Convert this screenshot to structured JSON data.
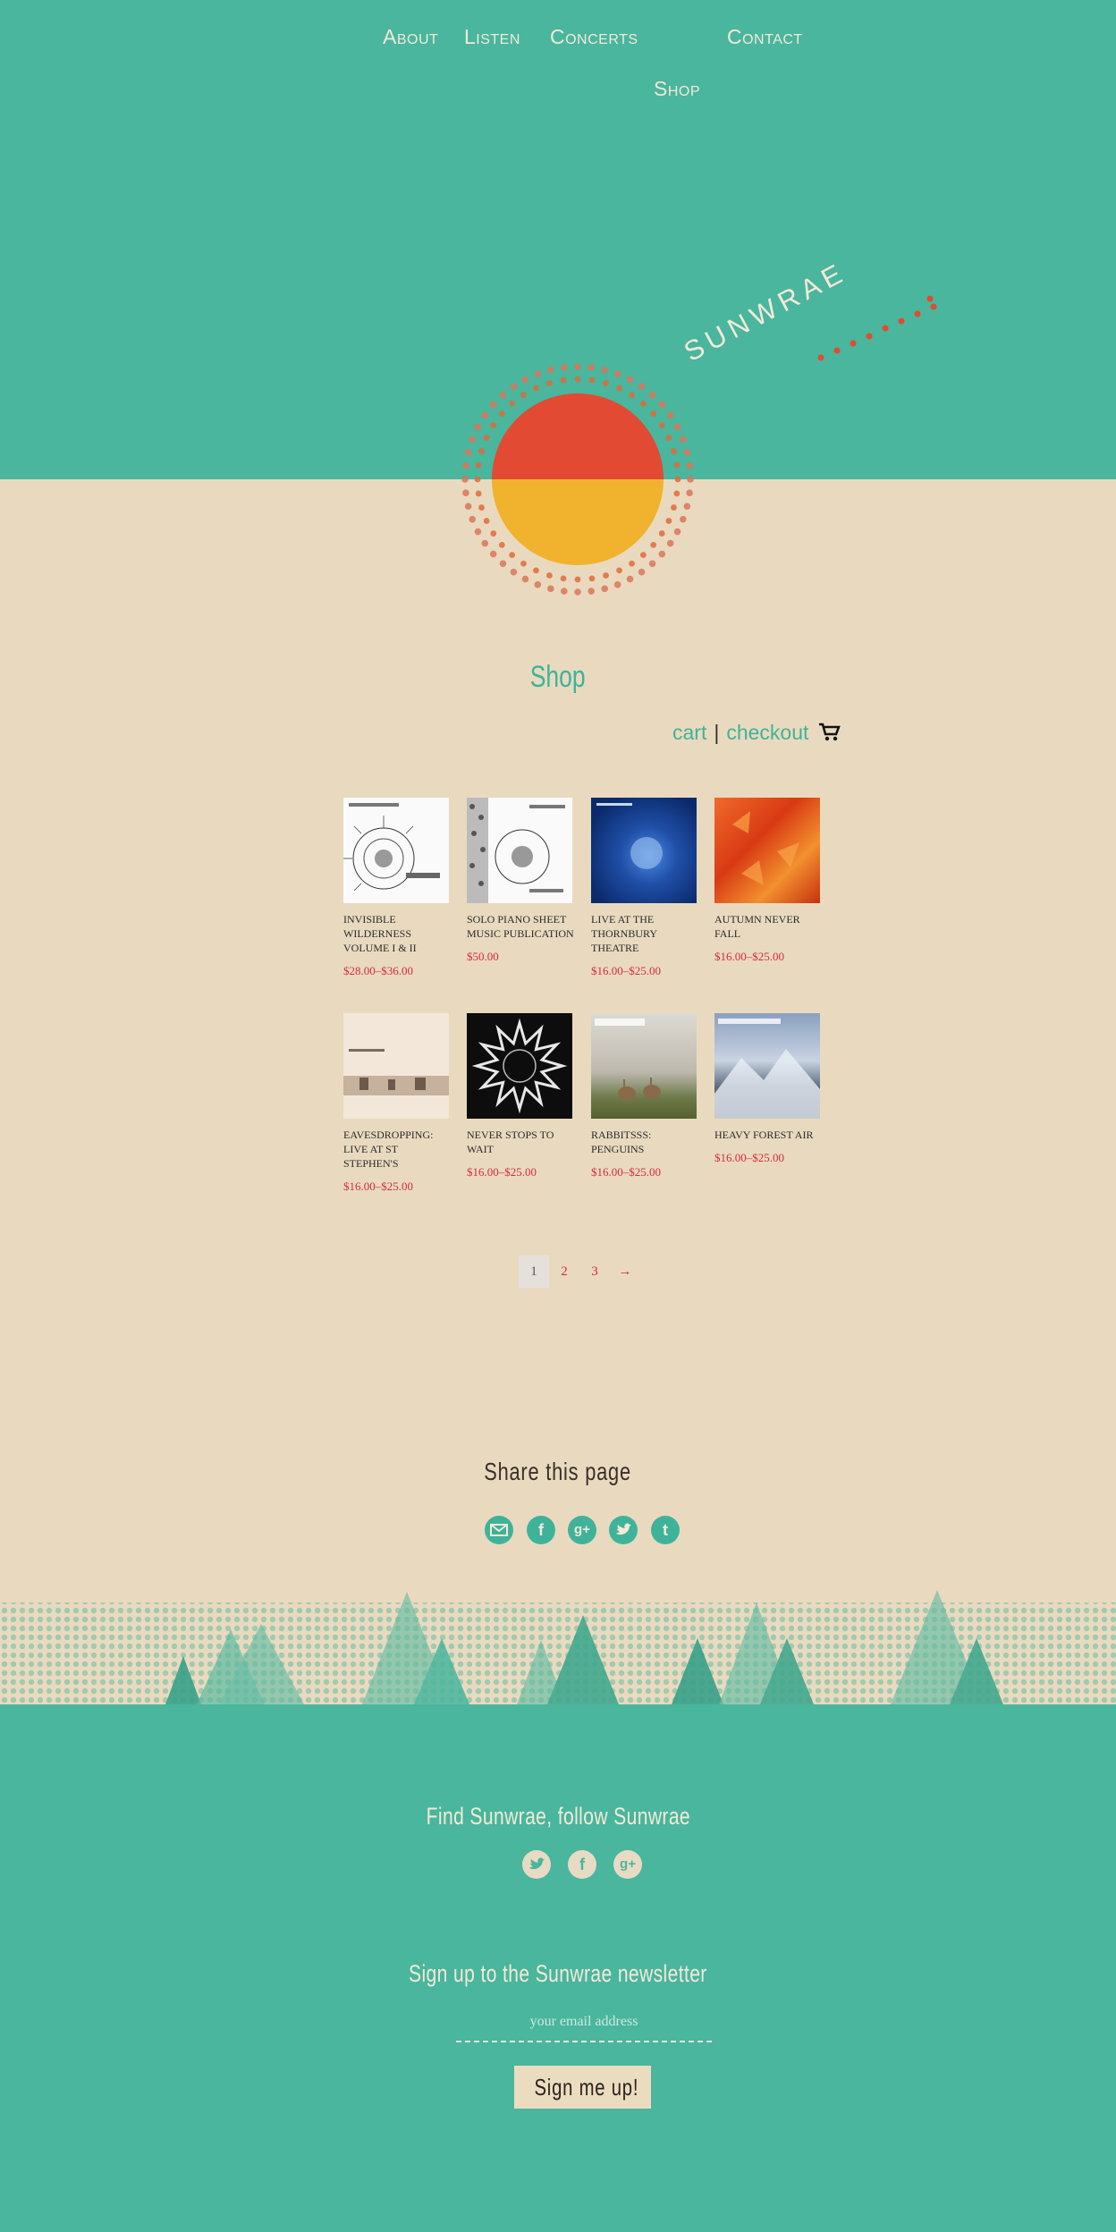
{
  "nav": {
    "items": [
      "About",
      "Listen",
      "Concerts",
      "Contact",
      "Shop"
    ]
  },
  "brand": {
    "name": "SUNWRAE"
  },
  "shop": {
    "title": "Shop",
    "cart_label": "cart",
    "separator": "|",
    "checkout_label": "checkout",
    "cart_icon": "shopping-cart-icon"
  },
  "products": [
    {
      "name": "INVISIBLE WILDERNESS VOLUME I & II",
      "price": "$28.00–$36.00"
    },
    {
      "name": "SOLO PIANO SHEET MUSIC PUBLICATION",
      "price": "$50.00"
    },
    {
      "name": "LIVE AT THE THORNBURY THEATRE",
      "price": "$16.00–$25.00"
    },
    {
      "name": "AUTUMN NEVER FALL",
      "price": "$16.00–$25.00"
    },
    {
      "name": "EAVESDROPPING: LIVE AT ST STEPHEN'S",
      "price": "$16.00–$25.00"
    },
    {
      "name": "NEVER STOPS TO WAIT",
      "price": "$16.00–$25.00"
    },
    {
      "name": "RABBITSSS: PENGUINS",
      "price": "$16.00–$25.00"
    },
    {
      "name": "HEAVY FOREST AIR",
      "price": "$16.00–$25.00"
    }
  ],
  "pagination": {
    "pages": [
      "1",
      "2",
      "3"
    ],
    "current": "1",
    "next": "→"
  },
  "share": {
    "title": "Share this page",
    "icons": [
      "email-icon",
      "facebook-icon",
      "google-plus-icon",
      "twitter-icon",
      "tumblr-icon"
    ]
  },
  "follow": {
    "title": "Find Sunwrae, follow Sunwrae",
    "icons": [
      "twitter-icon",
      "facebook-icon",
      "google-plus-icon"
    ]
  },
  "newsletter": {
    "title": "Sign up to the Sunwrae newsletter",
    "placeholder": "your email address",
    "button_label": "Sign me up!"
  },
  "colors": {
    "teal": "#49b69d",
    "paper": "#e9dabf",
    "sun_red": "#e24a33",
    "sun_yellow": "#f1b22d",
    "price_red": "#d9293c"
  }
}
